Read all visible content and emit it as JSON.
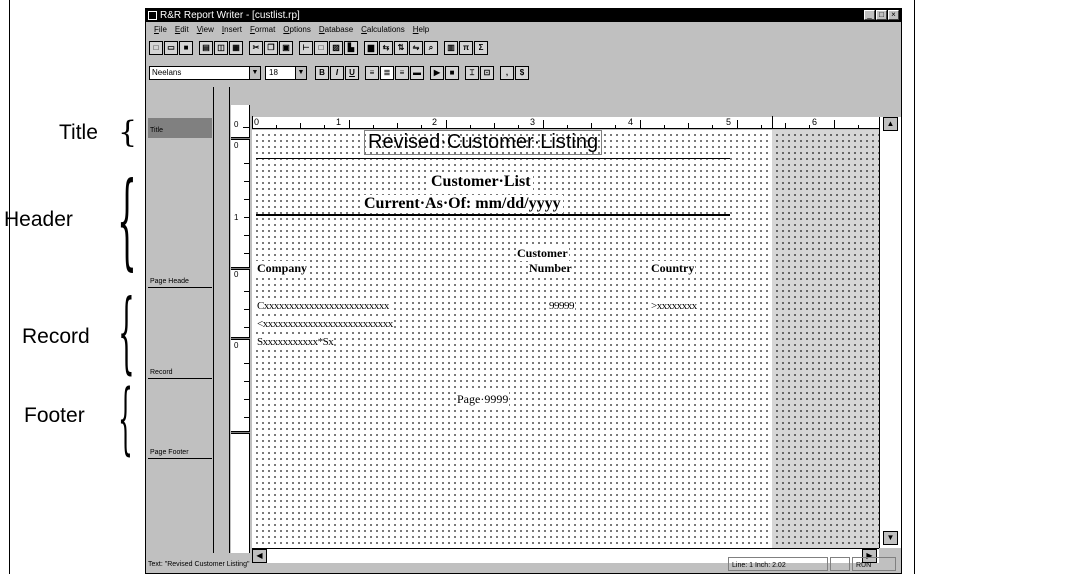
{
  "annotations": {
    "title": "Title",
    "header": "Header",
    "record": "Record",
    "footer": "Footer"
  },
  "window": {
    "title": "R&R Report Writer - [custlist.rp]",
    "buttons": [
      "_",
      "□",
      "×"
    ]
  },
  "menu": [
    "File",
    "Edit",
    "View",
    "Insert",
    "Format",
    "Options",
    "Database",
    "Calculations",
    "Help"
  ],
  "toolbar1_icons": [
    "new-icon",
    "open-icon",
    "save-icon",
    "print-icon",
    "preview-icon",
    "print-setup-icon",
    "cut-icon",
    "copy-icon",
    "paste-icon",
    "line-icon",
    "box-icon",
    "picture-icon",
    "chart-icon",
    "field-icon",
    "insert-field-icon",
    "sort-icon",
    "group-icon",
    "filter-icon",
    "expression-icon",
    "pi-icon",
    "sum-icon"
  ],
  "format_bar": {
    "font": "Neelans",
    "size": "18",
    "bold": "B",
    "italic": "I",
    "underline": "U"
  },
  "sections": {
    "title": "Title",
    "page_header": "Page Heade",
    "record": "Record",
    "page_footer": "Page Footer"
  },
  "ruler": {
    "h_numbers": [
      "0",
      "1",
      "2",
      "3",
      "4",
      "5",
      "6"
    ],
    "v_numbers": [
      "0",
      "0",
      "1",
      "0",
      "0"
    ]
  },
  "report": {
    "title": "Revised·Customer·Listing",
    "header_line1": "Customer·List",
    "header_line2": "Current·As·Of: mm/dd/yyyy",
    "col_customer": "Customer",
    "col_company": "Company",
    "col_number": "Number",
    "col_country": "Country",
    "rec_company": "Cxxxxxxxxxxxxxxxxxxxxxxxxx",
    "rec_number": "99999",
    "rec_country": ">xxxxxxxx",
    "rec_line2": "<xxxxxxxxxxxxxxxxxxxxxxxxxx",
    "rec_line3": "Sxxxxxxxxxxx*Sx",
    "footer_page": "Page·9999"
  },
  "status": {
    "text": "Text: \"Revised Customer Listing\"",
    "position": "Line: 1   Inch: 2.02",
    "mode": "RUN"
  }
}
